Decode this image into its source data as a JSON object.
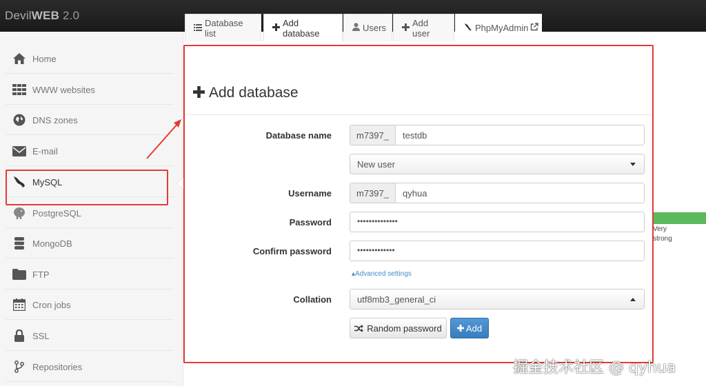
{
  "app": {
    "brand_light": "Devil",
    "brand_bold": "WEB",
    "version": " 2.0"
  },
  "sidebar": {
    "items": [
      {
        "label": "Home",
        "icon": "home-icon"
      },
      {
        "label": "WWW websites",
        "icon": "grid-icon"
      },
      {
        "label": "DNS zones",
        "icon": "globe-icon"
      },
      {
        "label": "E-mail",
        "icon": "envelope-icon"
      },
      {
        "label": "MySQL",
        "icon": "mysql-dolphin-icon",
        "active": true
      },
      {
        "label": "PostgreSQL",
        "icon": "postgresql-elephant-icon"
      },
      {
        "label": "MongoDB",
        "icon": "database-stack-icon"
      },
      {
        "label": "FTP",
        "icon": "folder-icon"
      },
      {
        "label": "Cron jobs",
        "icon": "calendar-icon"
      },
      {
        "label": "SSL",
        "icon": "lock-icon"
      },
      {
        "label": "Repositories",
        "icon": "branch-icon"
      }
    ]
  },
  "tabs": [
    {
      "label": "Database list",
      "icon": "list-icon"
    },
    {
      "label": "Add database",
      "icon": "plus-icon",
      "active": true
    },
    {
      "label": "Users",
      "icon": "user-icon"
    },
    {
      "label": "Add user",
      "icon": "plus-icon"
    },
    {
      "label": "PhpMyAdmin",
      "icon": "phpmyadmin-icon",
      "external_icon": "external-link-icon"
    }
  ],
  "form": {
    "title": "Add database",
    "database_name": {
      "label": "Database name",
      "prefix": "m7397_",
      "value": "testdb"
    },
    "user_select": {
      "value": "New user"
    },
    "username": {
      "label": "Username",
      "prefix": "m7397_",
      "value": "qyhua"
    },
    "password": {
      "label": "Password",
      "value": "••••••••••••••"
    },
    "confirm_password": {
      "label": "Confirm password",
      "value": "•••••••••••••"
    },
    "advanced_link": "Advanced settings",
    "collation": {
      "label": "Collation",
      "value": "utf8mb3_general_ci"
    },
    "random_password_button": "Random password",
    "add_button": "Add"
  },
  "password_strength": {
    "line1": "Very",
    "line2": "strong",
    "color": "#5cb85c"
  },
  "watermark": "掘金技术社区 @ qyhua",
  "colors": {
    "annotation_red": "#e53935",
    "primary": "#428bca"
  }
}
